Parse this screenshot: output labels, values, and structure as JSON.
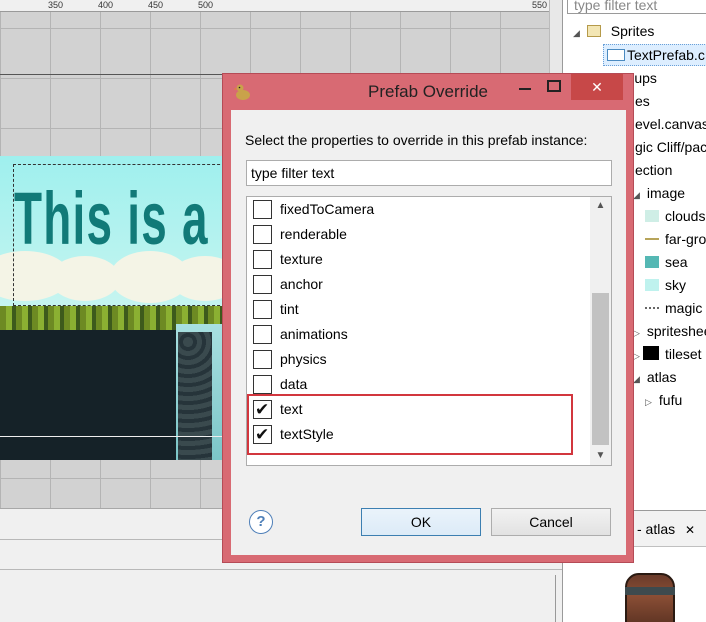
{
  "ruler": {
    "ticks": [
      "350",
      "400",
      "450",
      "500",
      "550"
    ]
  },
  "scene": {
    "text_fragment": "This is a te"
  },
  "tree": {
    "filter_placeholder": "type filter text",
    "items": [
      {
        "label": "Sprites"
      },
      {
        "label": "TextPrefab.c"
      },
      {
        "label": "Groups"
      },
      {
        "label": "es"
      },
      {
        "label": "evel.canvas"
      },
      {
        "label": "gic Cliff/pac"
      },
      {
        "label": "ection"
      },
      {
        "label": "image"
      },
      {
        "label": "clouds"
      },
      {
        "label": "far-gro"
      },
      {
        "label": "sea"
      },
      {
        "label": "sky"
      },
      {
        "label": "magic"
      },
      {
        "label": "spritesheet"
      },
      {
        "label": "tileset"
      },
      {
        "label": "atlas"
      },
      {
        "label": "fufu"
      }
    ],
    "atlas_tab": "w - atlas",
    "atlas_close": "✕"
  },
  "dialog": {
    "title": "Prefab Override",
    "prompt": "Select the properties to override in this prefab instance:",
    "filter_value": "type filter text",
    "properties": [
      {
        "label": "fixedToCamera",
        "checked": false
      },
      {
        "label": "renderable",
        "checked": false
      },
      {
        "label": "texture",
        "checked": false
      },
      {
        "label": "anchor",
        "checked": false
      },
      {
        "label": "tint",
        "checked": false
      },
      {
        "label": "animations",
        "checked": false
      },
      {
        "label": "physics",
        "checked": false
      },
      {
        "label": "data",
        "checked": false
      },
      {
        "label": "text",
        "checked": true
      },
      {
        "label": "textStyle",
        "checked": true
      }
    ],
    "help_icon": "?",
    "ok_label": "OK",
    "cancel_label": "Cancel",
    "accent_color": "#d86a73",
    "highlight_color": "#d2363e"
  }
}
